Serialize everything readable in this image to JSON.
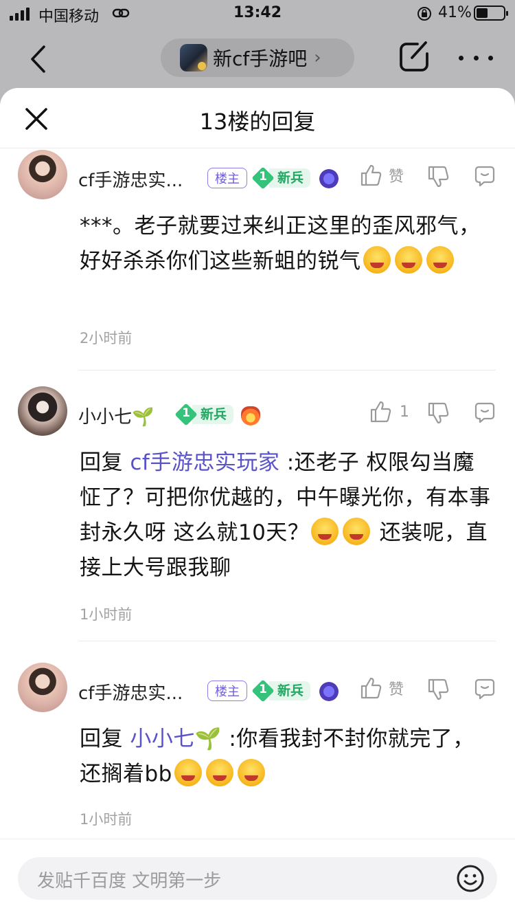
{
  "status_bar": {
    "carrier": "中国移动",
    "time": "13:42",
    "battery": "41%",
    "battery_level": 0.41
  },
  "nav": {
    "forum_name": "新cf手游吧",
    "chevron": "›"
  },
  "sheet": {
    "title": "13楼的回复"
  },
  "replies": [
    {
      "username": "cf手游忠实...",
      "owner_badge": "楼主",
      "level": "1",
      "level_label": "新兵",
      "medal": "purple-medal-icon",
      "like_label": "赞",
      "text": "***。老子就要过来纠正这里的歪风邪气，好好杀杀你们这些新蛆的锐气",
      "time": "2小时前"
    },
    {
      "username": "小小七🌱",
      "level": "1",
      "level_label": "新兵",
      "medal": "fire-medal-icon",
      "like_label": "1",
      "prefix": "回复",
      "mention": "cf手游忠实玩家",
      "text_a": ":还老子 权限勾当魔怔了？可把你优越的，中午曝光你，有本事封永久呀 这么就10天？",
      "text_b": "还装呢，直接上大号跟我聊",
      "time": "1小时前"
    },
    {
      "username": "cf手游忠实...",
      "owner_badge": "楼主",
      "level": "1",
      "level_label": "新兵",
      "medal": "purple-medal-icon",
      "like_label": "赞",
      "prefix": "回复",
      "mention": "小小七🌱",
      "text": ":你看我封不封你就完了，还搁着bb",
      "time": "1小时前"
    }
  ],
  "input": {
    "placeholder": "发贴千百度 文明第一步"
  }
}
